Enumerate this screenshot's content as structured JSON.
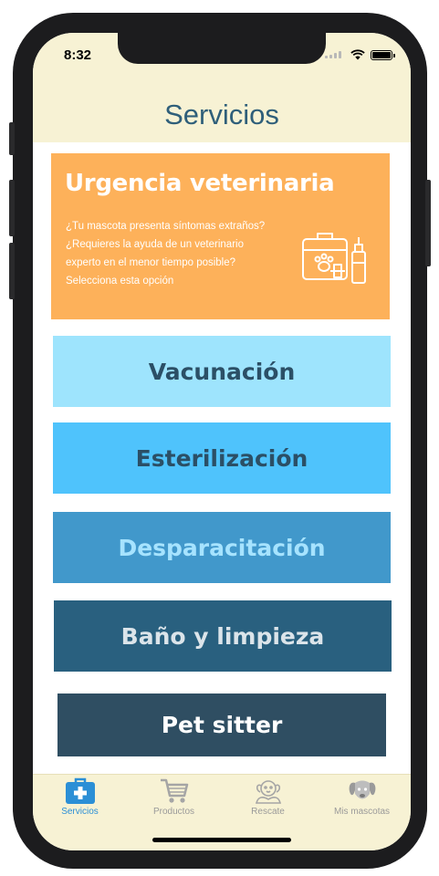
{
  "status_bar": {
    "time": "8:32"
  },
  "header": {
    "title": "Servicios"
  },
  "urgent_card": {
    "title": "Urgencia veterinaria",
    "description_lines": [
      "¿Tu mascota presenta síntomas extraños?",
      "¿Requieres la ayuda de un veterinario",
      "experto en el menor tiempo posible?",
      "Selecciona esta opción"
    ],
    "background": "#fdb15a"
  },
  "services": [
    {
      "label": "Vacunación",
      "bg": "#9ee4fd",
      "fg": "#2b4f66"
    },
    {
      "label": "Esterilización",
      "bg": "#4fc3fc",
      "fg": "#2b4f66"
    },
    {
      "label": "Desparacitación",
      "bg": "#4198cb",
      "fg": "#a6e3ff"
    },
    {
      "label": "Baño y limpieza",
      "bg": "#29607f",
      "fg": "#dbe4ea"
    },
    {
      "label": "Pet sitter",
      "bg": "#2f4e62",
      "fg": "#ffffff"
    }
  ],
  "tabbar": {
    "tabs": [
      {
        "label": "Servicios",
        "icon": "medical-kit-icon",
        "active": true
      },
      {
        "label": "Productos",
        "icon": "shopping-cart-icon",
        "active": false
      },
      {
        "label": "Rescate",
        "icon": "rescue-dog-icon",
        "active": false
      },
      {
        "label": "Mis mascotas",
        "icon": "dog-face-icon",
        "active": false
      }
    ],
    "active_color": "#2b8fd6",
    "inactive_color": "#9a9a9a"
  }
}
